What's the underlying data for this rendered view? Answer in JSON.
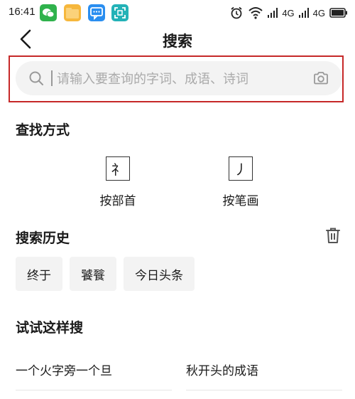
{
  "status_bar": {
    "time": "16:41",
    "icons": [
      "wechat-icon",
      "folder-icon",
      "message-icon",
      "scan-icon",
      "alarm-icon",
      "wifi-icon",
      "signal-icon",
      "signal-icon"
    ],
    "network_1": "4G",
    "network_2": "4G"
  },
  "header": {
    "back_icon": "back-arrow-icon",
    "title": "搜索"
  },
  "search": {
    "placeholder": "请输入要查询的字词、成语、诗词",
    "value": "",
    "left_icon": "search-icon",
    "right_icon": "camera-icon"
  },
  "find_methods": {
    "title": "查找方式",
    "items": [
      {
        "glyph": "礻",
        "label": "按部首"
      },
      {
        "glyph": "丿",
        "label": "按笔画"
      }
    ]
  },
  "history": {
    "title": "搜索历史",
    "clear_icon": "trash-icon",
    "items": [
      "终于",
      "饕餮",
      "今日头条"
    ]
  },
  "suggestions": {
    "title": "试试这样搜",
    "items": [
      "一个火字旁一个旦",
      "秋开头的成语"
    ]
  },
  "colors": {
    "highlight_border": "#c62828",
    "search_bg": "#f3f3f3",
    "chip_bg": "#f3f3f3"
  }
}
